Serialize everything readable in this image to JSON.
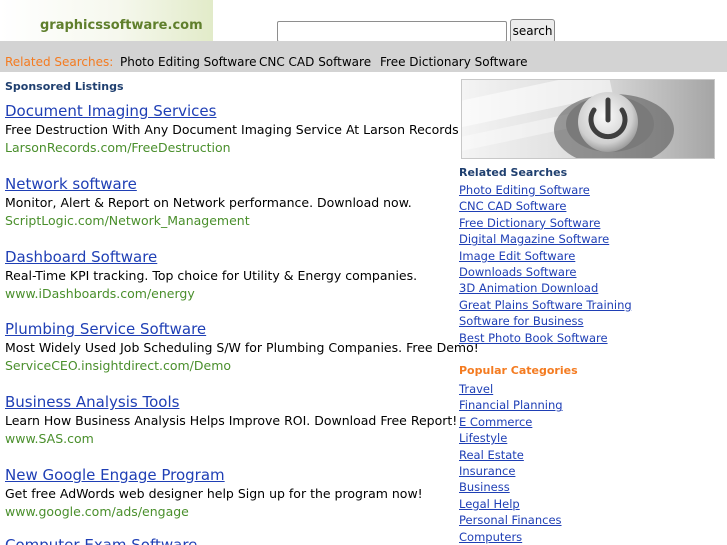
{
  "header": {
    "logo": "graphicssoftware.com",
    "search_button": "search",
    "search_value": ""
  },
  "related_bar": {
    "label": "Related Searches:",
    "items": [
      "Photo Editing Software",
      "CNC CAD Software",
      "Free Dictionary Software"
    ]
  },
  "sponsored": {
    "heading": "Sponsored Listings",
    "listings": [
      {
        "title": "Document Imaging Services",
        "desc": "Free Destruction With Any Document Imaging Service At Larson Records",
        "url": "LarsonRecords.com/FreeDestruction"
      },
      {
        "title": "Network software",
        "desc": "Monitor, Alert & Report on Network performance. Download now.",
        "url": "ScriptLogic.com/Network_Management"
      },
      {
        "title": "Dashboard Software",
        "desc": "Real-Time KPI tracking. Top choice for Utility & Energy companies.",
        "url": "www.iDashboards.com/energy"
      },
      {
        "title": "Plumbing Service Software",
        "desc": "Most Widely Used Job Scheduling S/W for Plumbing Companies. Free Demo!",
        "url": "ServiceCEO.insightdirect.com/Demo"
      },
      {
        "title": "Business Analysis Tools",
        "desc": "Learn How Business Analysis Helps Improve ROI. Download Free Report!",
        "url": "www.SAS.com"
      },
      {
        "title": "New Google Engage Program",
        "desc": "Get free AdWords web designer help Sign up for the program now!",
        "url": "www.google.com/ads/engage"
      },
      {
        "title": "Computer Exam Software",
        "desc": "",
        "url": ""
      }
    ]
  },
  "sidebar": {
    "related_heading": "Related Searches",
    "related_items": [
      "Photo Editing Software",
      "CNC CAD Software",
      "Free Dictionary Software",
      "Digital Magazine Software",
      "Image Edit Software",
      "Downloads Software",
      "3D Animation Download",
      "Great Plains Software Training",
      "Software for Business",
      "Best Photo Book Software"
    ],
    "popular_heading": "Popular Categories",
    "popular_items": [
      "Travel",
      "Financial Planning",
      "E Commerce",
      "Lifestyle",
      "Real Estate",
      "Insurance",
      "Business",
      "Legal Help",
      "Personal Finances",
      "Computers"
    ]
  },
  "colors": {
    "accent_orange": "#f47b20",
    "link_blue": "#1f3fb5",
    "url_green": "#4a8f2c",
    "bar_gray": "#d3d3d3",
    "heading_navy": "#1f3f6f"
  },
  "icons": {
    "side_image": "power-button-icon"
  }
}
